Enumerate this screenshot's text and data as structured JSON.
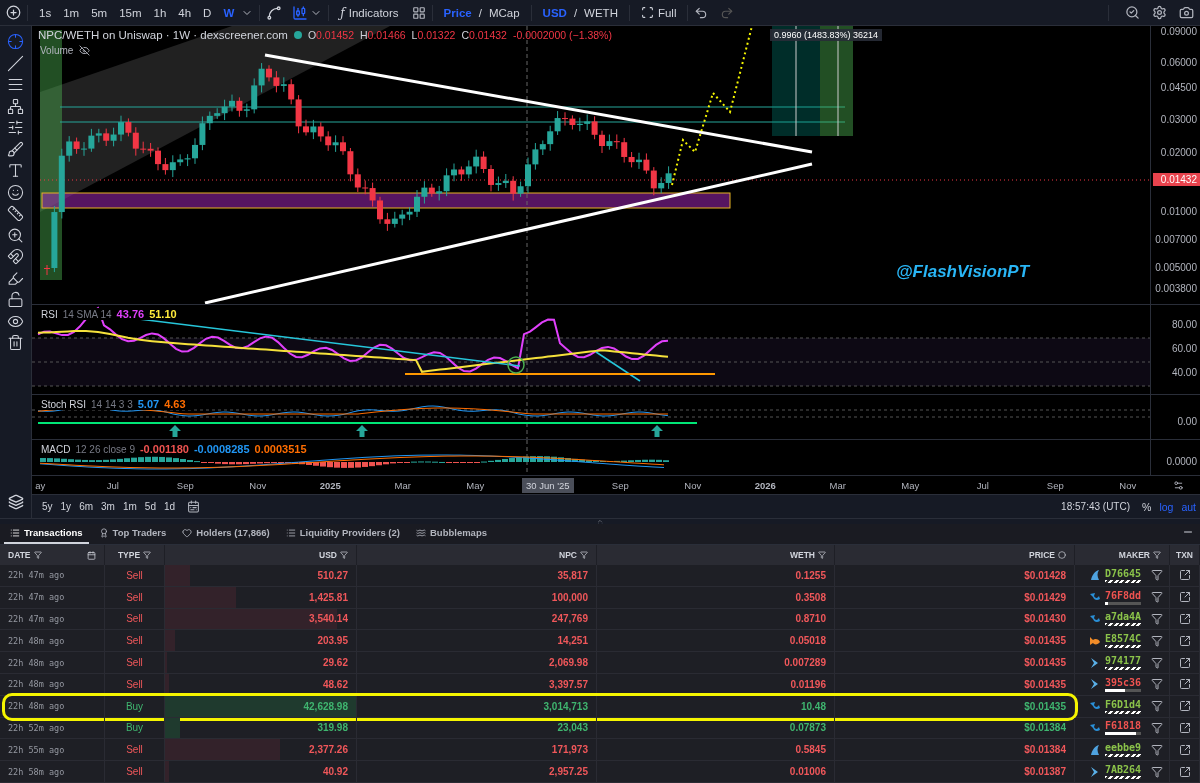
{
  "toolbar": {
    "intervals": [
      {
        "label": "1s",
        "selected": false
      },
      {
        "label": "1m",
        "selected": false
      },
      {
        "label": "5m",
        "selected": false
      },
      {
        "label": "15m",
        "selected": false
      },
      {
        "label": "1h",
        "selected": false
      },
      {
        "label": "4h",
        "selected": false
      },
      {
        "label": "D",
        "selected": false
      },
      {
        "label": "W",
        "selected": true
      }
    ],
    "indicators_symbol": "ƒ",
    "indicators": "Indicators",
    "price_toggle": [
      {
        "label": "Price",
        "selected": true
      },
      {
        "label": "MCap",
        "selected": false
      }
    ],
    "currency_toggle": [
      {
        "label": "USD",
        "selected": true
      },
      {
        "label": "WETH",
        "selected": false
      }
    ],
    "separator": "/",
    "full": "Full"
  },
  "legend": {
    "title": "NPC/WETH on Uniswap · 1W · dexscreener.com",
    "ohlc": [
      {
        "key": "O",
        "value": "0.01452"
      },
      {
        "key": "H",
        "value": "0.01466"
      },
      {
        "key": "L",
        "value": "0.01322"
      },
      {
        "key": "C",
        "value": "0.01432"
      }
    ],
    "change": "-0.0002000 (−1.38%)",
    "volume": "Volume"
  },
  "tooltip": "0.9960 (1483.83%) 36214",
  "annotation": "@FlashVisionPT",
  "price_axis": [
    "0.09000",
    "0.06000",
    "0.04500",
    "0.03000",
    "0.02000",
    "0.01000",
    "0.007000",
    "0.005000",
    "0.003800"
  ],
  "current_price": "0.01432",
  "rsi": {
    "name": "RSI",
    "params": "14 SMA 14",
    "values": [
      {
        "text": "43.76",
        "color": "#e040fb"
      },
      {
        "text": "51.10",
        "color": "#ffeb3b"
      }
    ],
    "axis": [
      "80.00",
      "60.00",
      "40.00"
    ]
  },
  "stoch_rsi": {
    "name": "Stoch RSI",
    "params": "14 14 3 3",
    "values": [
      {
        "text": "5.07",
        "color": "#2196f3"
      },
      {
        "text": "4.63",
        "color": "#ff6d00"
      }
    ],
    "axis": [
      "0.00"
    ]
  },
  "macd": {
    "name": "MACD",
    "params": "12 26 close 9",
    "values": [
      {
        "text": "-0.001180",
        "color": "#ef5350"
      },
      {
        "text": "-0.0008285",
        "color": "#2196f3"
      },
      {
        "text": "0.0003515",
        "color": "#ff6d00"
      }
    ],
    "axis": [
      "0.0000"
    ]
  },
  "time_axis": [
    {
      "label": "ay",
      "bold": false,
      "crosshair": false
    },
    {
      "label": "Jul",
      "bold": false,
      "crosshair": false
    },
    {
      "label": "Sep",
      "bold": false,
      "crosshair": false
    },
    {
      "label": "Nov",
      "bold": false,
      "crosshair": false
    },
    {
      "label": "2025",
      "bold": true,
      "crosshair": false
    },
    {
      "label": "Mar",
      "bold": false,
      "crosshair": false
    },
    {
      "label": "May",
      "bold": false,
      "crosshair": false
    },
    {
      "label": "30 Jun '25",
      "bold": false,
      "crosshair": true
    },
    {
      "label": "Sep",
      "bold": false,
      "crosshair": false
    },
    {
      "label": "Nov",
      "bold": false,
      "crosshair": false
    },
    {
      "label": "2026",
      "bold": true,
      "crosshair": false
    },
    {
      "label": "Mar",
      "bold": false,
      "crosshair": false
    },
    {
      "label": "May",
      "bold": false,
      "crosshair": false
    },
    {
      "label": "Jul",
      "bold": false,
      "crosshair": false
    },
    {
      "label": "Sep",
      "bold": false,
      "crosshair": false
    },
    {
      "label": "Nov",
      "bold": false,
      "crosshair": false
    }
  ],
  "range_buttons": [
    "5y",
    "1y",
    "6m",
    "3m",
    "1m",
    "5d",
    "1d"
  ],
  "clock": "18:57:43 (UTC)",
  "scale_options": [
    {
      "label": "%",
      "selected": false
    },
    {
      "label": "log",
      "selected": false
    },
    {
      "label": "aut",
      "selected": false
    }
  ],
  "tabs": [
    {
      "label": "Transactions",
      "selected": true
    },
    {
      "label": "Top Traders",
      "selected": false
    },
    {
      "label": "Holders (17,866)",
      "selected": false
    },
    {
      "label": "Liquidity Providers (2)",
      "selected": false
    },
    {
      "label": "Bubblemaps",
      "selected": false
    }
  ],
  "table": {
    "columns": [
      "DATE",
      "TYPE",
      "USD",
      "NPC",
      "WETH",
      "PRICE",
      "MAKER",
      "TXN"
    ],
    "rows": [
      {
        "date": "22h 47m ago",
        "kind": "sell",
        "type": "Sell",
        "usd": "510.27",
        "npc": "35,817",
        "weth": "0.1255",
        "price": "$0.01428",
        "level": 0.13,
        "maker": {
          "name": "D76645",
          "kind": "shark",
          "color": "#8bc34a"
        },
        "highlighted": false
      },
      {
        "date": "22h 47m ago",
        "kind": "sell",
        "type": "Sell",
        "usd": "1,425.81",
        "npc": "100,000",
        "weth": "0.3508",
        "price": "$0.01429",
        "level": 0.37,
        "maker": {
          "name": "76F8dd",
          "kind": "whale",
          "color": "#ef5350",
          "level": 0.1
        },
        "highlighted": false
      },
      {
        "date": "22h 47m ago",
        "kind": "sell",
        "type": "Sell",
        "usd": "3,540.14",
        "npc": "247,769",
        "weth": "0.8710",
        "price": "$0.01430",
        "level": 0.9,
        "maker": {
          "name": "a7da4A",
          "kind": "whale",
          "color": "#8bc34a"
        },
        "highlighted": false
      },
      {
        "date": "22h 48m ago",
        "kind": "sell",
        "type": "Sell",
        "usd": "203.95",
        "npc": "14,251",
        "weth": "0.05018",
        "price": "$0.01435",
        "level": 0.05,
        "maker": {
          "name": "E8574C",
          "kind": "fish",
          "color": "#8bc34a"
        },
        "highlighted": false
      },
      {
        "date": "22h 48m ago",
        "kind": "sell",
        "type": "Sell",
        "usd": "29.62",
        "npc": "2,069.98",
        "weth": "0.007289",
        "price": "$0.01435",
        "level": 0.01,
        "maker": {
          "name": "974177",
          "kind": "dolphin",
          "color": "#8bc34a"
        },
        "highlighted": false
      },
      {
        "date": "22h 48m ago",
        "kind": "sell",
        "type": "Sell",
        "usd": "48.62",
        "npc": "3,397.57",
        "weth": "0.01196",
        "price": "$0.01435",
        "level": 0.02,
        "maker": {
          "name": "395c36",
          "kind": "dolphin",
          "color": "#ef5350",
          "level": 0.55
        },
        "highlighted": false
      },
      {
        "date": "22h 48m ago",
        "kind": "buy",
        "type": "Buy",
        "usd": "42,628.98",
        "npc": "3,014,713",
        "weth": "10.48",
        "price": "$0.01435",
        "level": 1,
        "maker": {
          "name": "F6D1d4",
          "kind": "whale",
          "color": "#8bc34a"
        },
        "highlighted": true
      },
      {
        "date": "22h 52m ago",
        "kind": "buy",
        "type": "Buy",
        "usd": "319.98",
        "npc": "23,043",
        "weth": "0.07873",
        "price": "$0.01384",
        "level": 0.08,
        "maker": {
          "name": "F61818",
          "kind": "whale",
          "color": "#ef5350",
          "level": 0.85
        },
        "highlighted": false
      },
      {
        "date": "22h 55m ago",
        "kind": "sell",
        "type": "Sell",
        "usd": "2,377.26",
        "npc": "171,973",
        "weth": "0.5845",
        "price": "$0.01384",
        "level": 0.6,
        "maker": {
          "name": "eebbe9",
          "kind": "shark",
          "color": "#8bc34a"
        },
        "highlighted": false
      },
      {
        "date": "22h 58m ago",
        "kind": "sell",
        "type": "Sell",
        "usd": "40.92",
        "npc": "2,957.25",
        "weth": "0.01006",
        "price": "$0.01387",
        "level": 0.02,
        "maker": {
          "name": "7AB264",
          "kind": "dolphin",
          "color": "#8bc34a"
        },
        "highlighted": false
      }
    ]
  }
}
